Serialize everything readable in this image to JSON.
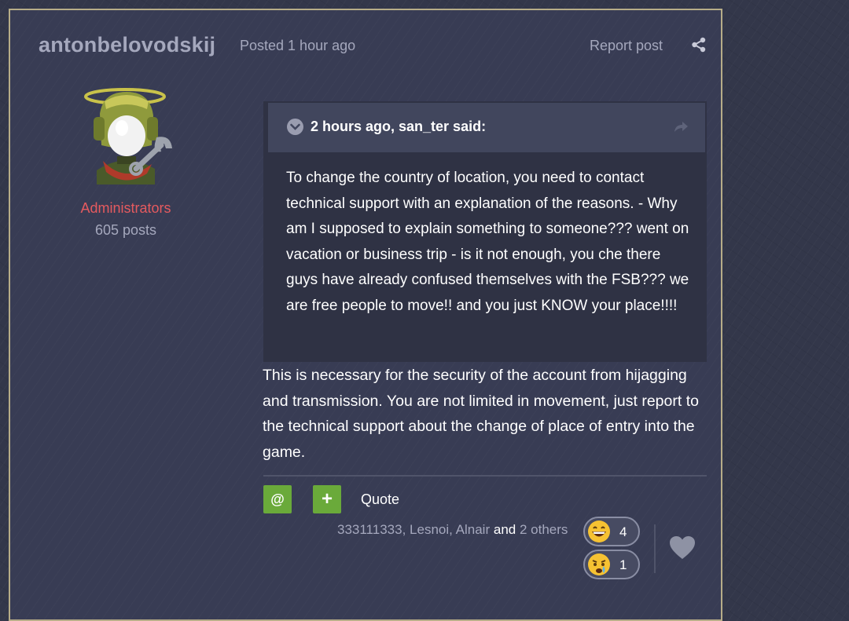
{
  "post": {
    "author": "antonbelovodskij",
    "posted": "Posted 1 hour ago",
    "report": "Report post",
    "group": "Administrators",
    "post_count": "605 posts",
    "quote": {
      "citation": "2 hours ago, san_ter said:",
      "text": "To change the country of location, you need to contact technical support with an explanation of the reasons. - Why am I supposed to explain something to someone??? went on vacation or business trip - is it not enough, you che there guys have already confused themselves with the FSB??? we are free people to move!! and you just KNOW your place!!!!"
    },
    "reply": "This is necessary for the security of the account from hijagging and transmission. You are not limited in movement, just report to the technical support about the change of place of entry into the game.",
    "actions": {
      "mention_label": "@",
      "multiquote_label": "+",
      "quote_label": "Quote"
    },
    "reactions": {
      "users": [
        "333111333",
        "Lesnoi",
        "Alnair"
      ],
      "sep": ", ",
      "and": "and",
      "others": "2 others",
      "items": [
        {
          "icon": "grinning-face-icon",
          "count": "4"
        },
        {
          "icon": "crying-face-icon",
          "count": "1"
        }
      ]
    }
  },
  "colors": {
    "page_bg": "#33374a",
    "post_border": "#b7ad88",
    "muted_text": "#a5a8bd",
    "group_color": "#e55a5f",
    "action_green": "#6aaa3a"
  }
}
